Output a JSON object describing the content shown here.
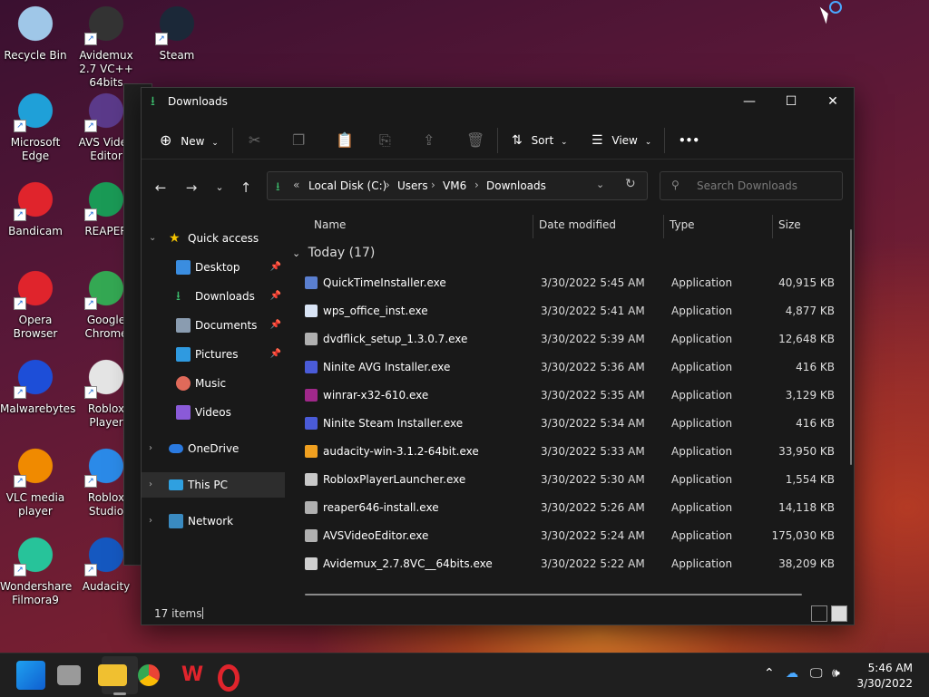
{
  "desktop": {
    "icons": [
      {
        "label": "Recycle Bin",
        "icon": "recycle-bin-icon",
        "color": "#9fc7e8"
      },
      {
        "label": "Avidemux 2.7 VC++ 64bits",
        "icon": "clapperboard-icon",
        "color": "#333333"
      },
      {
        "label": "Steam",
        "icon": "steam-icon",
        "color": "#1b2838"
      },
      {
        "label": "Microsoft Edge",
        "icon": "edge-icon",
        "color": "#1fa0d8"
      },
      {
        "label": "AVS Video Editor",
        "icon": "film-strip-icon",
        "color": "#5b3a8a"
      },
      {
        "label": "Bandicam",
        "icon": "record-icon",
        "color": "#e0242c"
      },
      {
        "label": "REAPER",
        "icon": "reaper-icon",
        "color": "#1a9a56"
      },
      {
        "label": "Opera Browser",
        "icon": "opera-icon",
        "color": "#e0242c"
      },
      {
        "label": "Google Chrome",
        "icon": "chrome-icon",
        "color": "#34a853"
      },
      {
        "label": "Malwarebytes",
        "icon": "malwarebytes-icon",
        "color": "#1d4ed8"
      },
      {
        "label": "Roblox Player",
        "icon": "roblox-icon",
        "color": "#e5e5e5"
      },
      {
        "label": "VLC media player",
        "icon": "traffic-cone-icon",
        "color": "#f08a00"
      },
      {
        "label": "Roblox Studio",
        "icon": "roblox-studio-icon",
        "color": "#2b8ae8"
      },
      {
        "label": "Wondershare Filmora9",
        "icon": "filmora-icon",
        "color": "#27c39a"
      },
      {
        "label": "Audacity",
        "icon": "headphones-icon",
        "color": "#1558c0"
      }
    ]
  },
  "window": {
    "title": "Downloads",
    "title_icon": "download-arrow-icon",
    "minimize": "—",
    "maximize": "☐",
    "close": "✕"
  },
  "commandbar": {
    "new_label": "New",
    "sort_label": "Sort",
    "view_label": "View",
    "more_label": "•••"
  },
  "address": {
    "overflow": "«",
    "crumbs": [
      "Local Disk (C:)",
      "Users",
      "VM6",
      "Downloads"
    ]
  },
  "search": {
    "placeholder": "Search Downloads"
  },
  "navpane": {
    "quick_access": "Quick access",
    "pinned": [
      "Desktop",
      "Downloads",
      "Documents",
      "Pictures"
    ],
    "unpinned": [
      "Music",
      "Videos"
    ],
    "onedrive": "OneDrive",
    "this_pc": "This PC",
    "network": "Network"
  },
  "filelist": {
    "columns": [
      "Name",
      "Date modified",
      "Type",
      "Size"
    ],
    "group": "Today (17)",
    "rows": [
      {
        "name": "QuickTimeInstaller.exe",
        "date": "3/30/2022 5:45 AM",
        "type": "Application",
        "size": "40,915 KB",
        "icon": "quicktime-icon",
        "color": "#5a7fd0"
      },
      {
        "name": "wps_office_inst.exe",
        "date": "3/30/2022 5:41 AM",
        "type": "Application",
        "size": "4,877 KB",
        "icon": "wps-icon",
        "color": "#d9e4f5"
      },
      {
        "name": "dvdflick_setup_1.3.0.7.exe",
        "date": "3/30/2022 5:39 AM",
        "type": "Application",
        "size": "12,648 KB",
        "icon": "installer-icon",
        "color": "#b0b0b0"
      },
      {
        "name": "Ninite AVG Installer.exe",
        "date": "3/30/2022 5:36 AM",
        "type": "Application",
        "size": "416 KB",
        "icon": "ninite-icon",
        "color": "#4a5bd8"
      },
      {
        "name": "winrar-x32-610.exe",
        "date": "3/30/2022 5:35 AM",
        "type": "Application",
        "size": "3,129 KB",
        "icon": "winrar-icon",
        "color": "#a0288a"
      },
      {
        "name": "Ninite Steam Installer.exe",
        "date": "3/30/2022 5:34 AM",
        "type": "Application",
        "size": "416 KB",
        "icon": "ninite-icon",
        "color": "#4a5bd8"
      },
      {
        "name": "audacity-win-3.1.2-64bit.exe",
        "date": "3/30/2022 5:33 AM",
        "type": "Application",
        "size": "33,950 KB",
        "icon": "audacity-icon",
        "color": "#f0a020"
      },
      {
        "name": "RobloxPlayerLauncher.exe",
        "date": "3/30/2022 5:30 AM",
        "type": "Application",
        "size": "1,554 KB",
        "icon": "roblox-icon",
        "color": "#c8c8c8"
      },
      {
        "name": "reaper646-install.exe",
        "date": "3/30/2022 5:26 AM",
        "type": "Application",
        "size": "14,118 KB",
        "icon": "installer-icon",
        "color": "#b0b0b0"
      },
      {
        "name": "AVSVideoEditor.exe",
        "date": "3/30/2022 5:24 AM",
        "type": "Application",
        "size": "175,030 KB",
        "icon": "installer-icon",
        "color": "#b0b0b0"
      },
      {
        "name": "Avidemux_2.7.8VC__64bits.exe",
        "date": "3/30/2022 5:22 AM",
        "type": "Application",
        "size": "38,209 KB",
        "icon": "clapperboard-icon",
        "color": "#d0d0d0"
      }
    ]
  },
  "statusbar": {
    "count": "17 items"
  },
  "taskbar": {
    "apps": [
      "start-icon",
      "task-view-icon",
      "file-explorer-icon",
      "chrome-icon",
      "wps-icon",
      "opera-icon"
    ],
    "time": "5:46 AM",
    "date": "3/30/2022"
  }
}
